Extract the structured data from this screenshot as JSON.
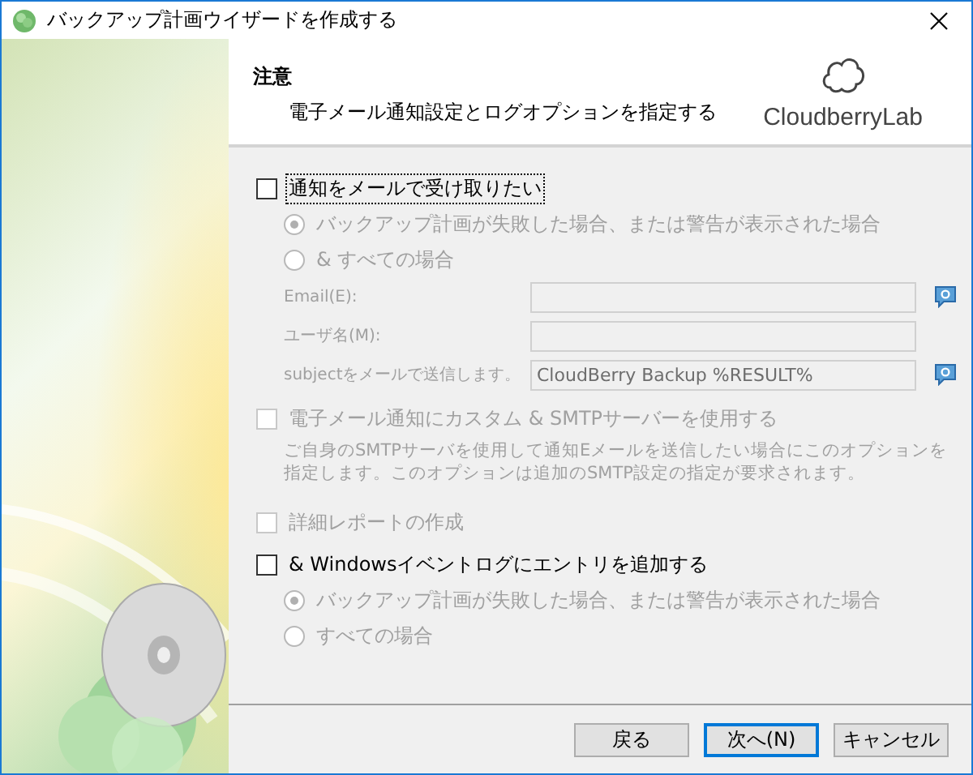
{
  "window": {
    "title": "バックアップ計画ウイザードを作成する"
  },
  "header": {
    "title": "注意",
    "subtitle": "電子メール通知設定とログオプションを指定する",
    "logo_text": "CloudberryLab"
  },
  "options": [
    {
      "kind": "checkbox",
      "label": "通知をメールで受け取りたい",
      "checked": false,
      "disabled": false,
      "focused": true
    },
    {
      "kind": "radio",
      "label": "バックアップ計画が失敗した場合、または警告が表示された場合",
      "selected": true,
      "disabled": true
    },
    {
      "kind": "radio",
      "label": "& すべての場合",
      "selected": false,
      "disabled": true
    },
    {
      "kind": "field",
      "label": "Email(E):",
      "disabled": true,
      "help": true
    },
    {
      "kind": "field",
      "label": "ユーザ名(M):",
      "disabled": true,
      "help": false
    },
    {
      "kind": "field",
      "label": "subjectをメールで送信します。",
      "value": "CloudBerry Backup %RESULT%",
      "disabled": true,
      "help": true
    },
    {
      "kind": "checkbox",
      "label": "電子メール通知にカスタム & SMTPサーバーを使用する",
      "checked": false,
      "disabled": true,
      "focused": false
    },
    {
      "kind": "note",
      "text": "ご自身のSMTPサーバを使用して通知Eメールを送信したい場合にこのオプションを指定します。このオプションは追加のSMTP設定の指定が要求されます。",
      "disabled": true
    },
    {
      "kind": "checkbox",
      "label": "詳細レポートの作成",
      "checked": false,
      "disabled": true,
      "focused": false
    },
    {
      "kind": "checkbox",
      "label": "& Windowsイベントログにエントリを追加する",
      "checked": false,
      "disabled": false,
      "focused": false
    },
    {
      "kind": "radio",
      "label": "バックアップ計画が失敗した場合、または警告が表示された場合",
      "selected": true,
      "disabled": true
    },
    {
      "kind": "radio",
      "label": "すべての場合",
      "selected": false,
      "disabled": true
    }
  ],
  "buttons": [
    {
      "label": "戻る",
      "default": false
    },
    {
      "label": "次へ(N)",
      "default": true
    },
    {
      "label": "キャンセル",
      "default": false
    }
  ]
}
